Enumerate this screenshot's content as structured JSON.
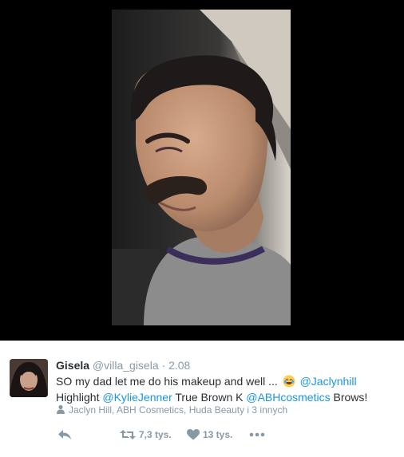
{
  "tweet": {
    "author_name": "Gisela",
    "author_handle": "@villa_gisela",
    "separator": "·",
    "timestamp": "2.08",
    "text_part1": "SO my dad let me do his makeup and well ...",
    "mention_jaclynhill": "@Jaclynhill",
    "text_part2": "Highlight",
    "mention_kyliejenner": "@KylieJenner",
    "text_part3": "True Brown K",
    "mention_abhcosmetics": "@ABHcosmetics",
    "text_part4": "Brows!",
    "emoji": "face-with-tears-of-joy",
    "tagged_people": "Jaclyn Hill, ABH Cosmetics, Huda Beauty i 3 innych"
  },
  "actions": {
    "reply_icon": "reply-icon",
    "retweet_icon": "retweet-icon",
    "retweet_count": "7,3 tys.",
    "like_icon": "heart-icon",
    "like_count": "13 tys.",
    "more_icon": "more-dots-icon"
  },
  "colors": {
    "link": "#1b95e0",
    "muted": "#8899a6",
    "text": "#292f33",
    "media_background": "#000000"
  }
}
